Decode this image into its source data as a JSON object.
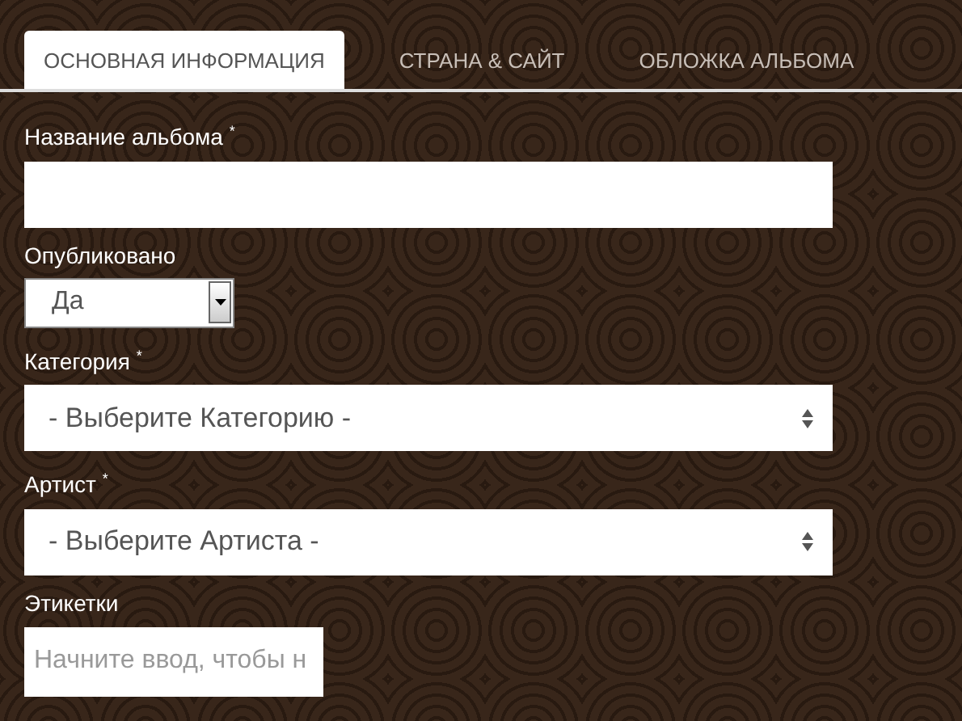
{
  "tabs": [
    {
      "label": "ОСНОВНАЯ ИНФОРМАЦИЯ",
      "selected": true
    },
    {
      "label": "СТРАНА & САЙТ",
      "selected": false
    },
    {
      "label": "ОБЛОЖКА АЛЬБОМА",
      "selected": false
    }
  ],
  "fields": [
    {
      "kind": "text",
      "label": "Название альбома $^{*}$"
    },
    {
      "kind": "dropdown",
      "label": "Опубликовано",
      "value": "Да"
    },
    {
      "kind": "select",
      "label": "Категория $^{*}$",
      "value": "- Выберите Категорию -"
    },
    {
      "kind": "select",
      "label": "Артист $^{*}$",
      "value": "- Выберите Артиста -"
    },
    {
      "kind": "tags",
      "label": "Этикетки",
      "placeholder": "Начните ввод, чтобы н"
    }
  ]
}
